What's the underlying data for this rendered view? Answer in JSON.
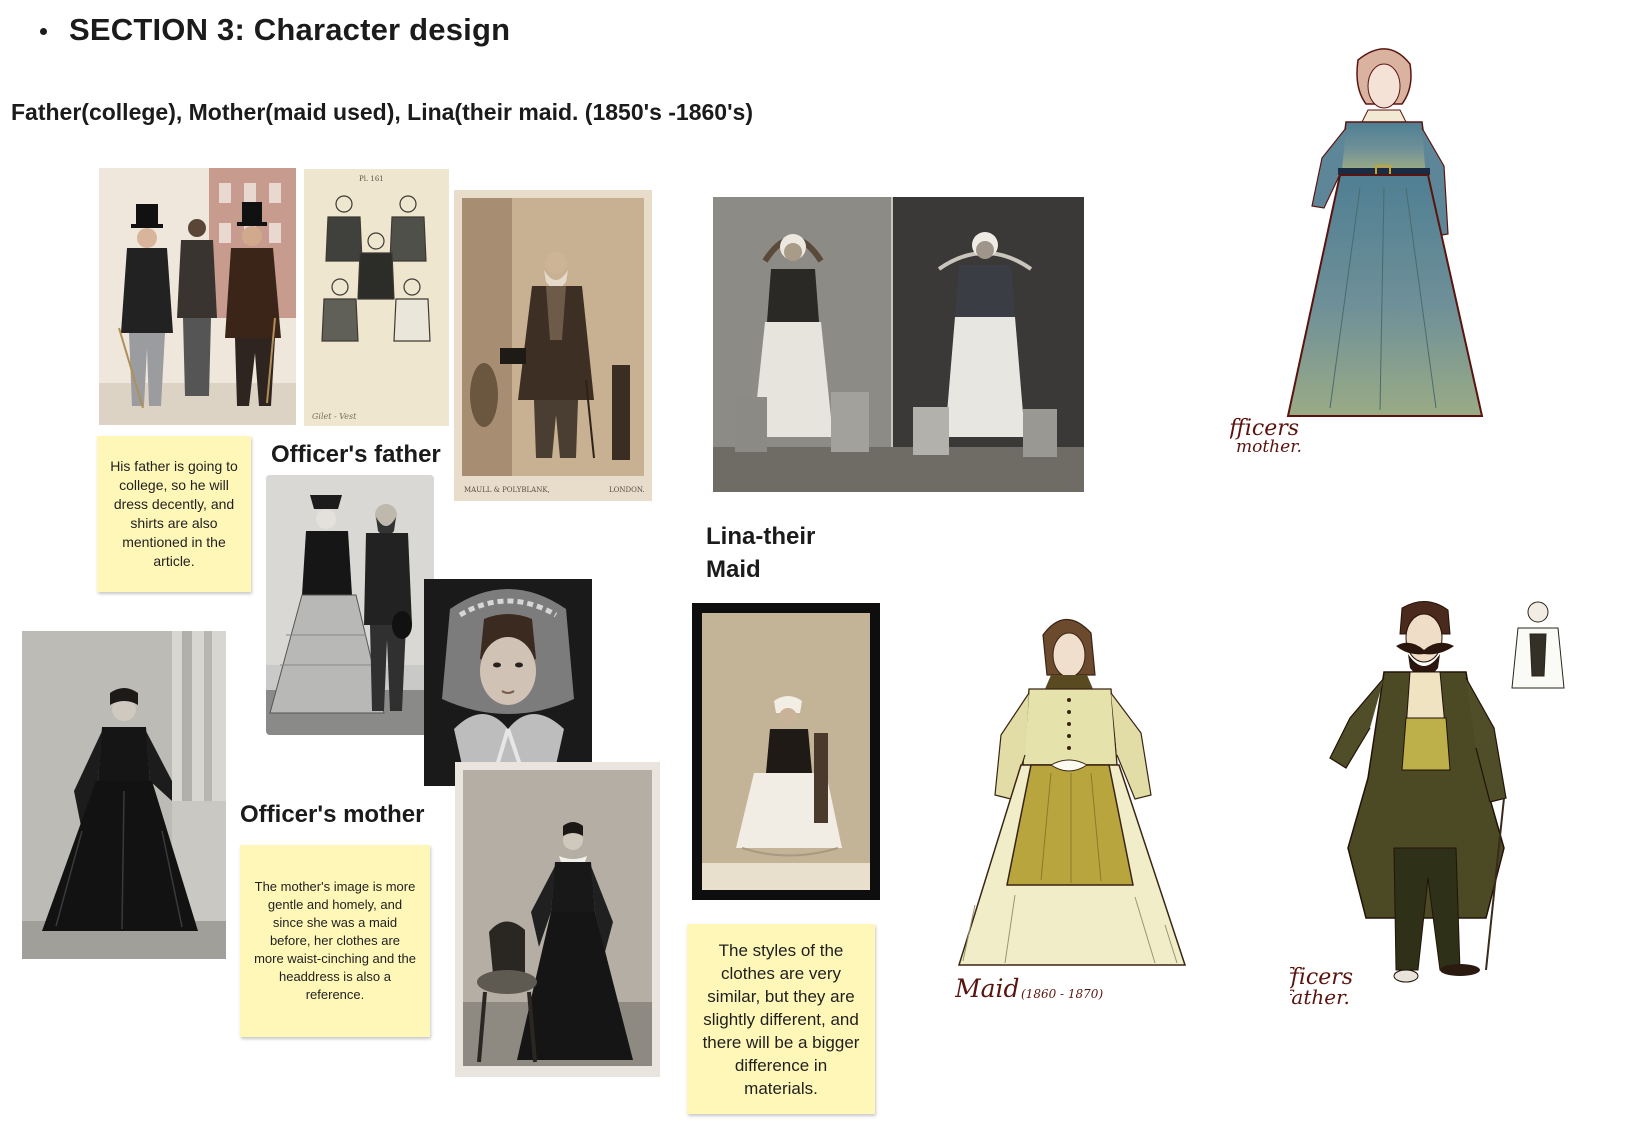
{
  "section": {
    "title": "SECTION 3: Character design",
    "bullet": "bullet-dot"
  },
  "subtitle": "Father(college), Mother(maid used), Lina(their maid. (1850's -1860's)",
  "labels": {
    "officers_father": "Officer's father",
    "officers_mother": "Officer's mother",
    "lina_line1": "Lina-their",
    "lina_line2": "Maid"
  },
  "notes": {
    "father": "His father is going to college, so he will dress decently, and shirts are also mentioned in the article.",
    "mother": "The mother's image is more gentle and homely, and since she was a maid before, her clothes are more waist-cinching and the headdress is also a reference.",
    "maid": "The styles of the clothes are very similar, but they are slightly different, and there will be a bigger difference in materials."
  },
  "photo_captions": {
    "waistcoat_plate_top": "Pl. 161",
    "waistcoat_plate_bottom": "Gilet - Vest",
    "portrait_studio_left": "MAULL & POLYBLANK,",
    "portrait_studio_right": "LONDON."
  },
  "sketch_captions": {
    "mother": [
      "officers",
      "mother."
    ],
    "maid": "Maid",
    "maid_years": "(1860 - 1870)",
    "father": [
      "officers",
      "father."
    ]
  },
  "colors": {
    "note_bg": "#fff7b8",
    "sketch_ink": "#5a1410",
    "mother_dress_top": "#4f7f93",
    "mother_dress_bottom": "#9aab85",
    "maid_bodice": "#e6e2ac",
    "maid_apron": "#b9a53d",
    "father_coat": "#4b4a25",
    "father_vest": "#bdb04a"
  }
}
